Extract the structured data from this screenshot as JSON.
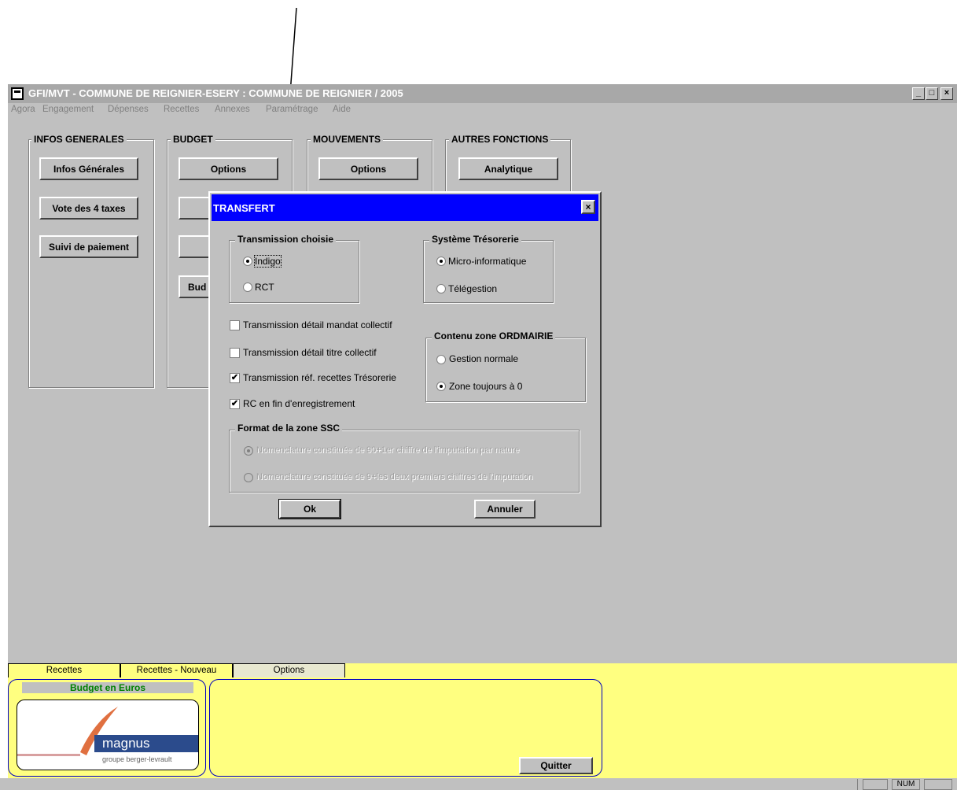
{
  "window": {
    "title": "GFI/MVT - COMMUNE DE REIGNIER-ESERY : COMMUNE DE REIGNIER / 2005",
    "controls": {
      "minimize": "_",
      "maximize": "□",
      "close": "×"
    }
  },
  "menu": [
    "Agora",
    "Engagement",
    "Dépenses",
    "Recettes",
    "Annexes",
    "Paramétrage",
    "Aide"
  ],
  "groups": {
    "infos": {
      "title": "INFOS GENERALES",
      "buttons": [
        "Infos Générales",
        "Vote des 4 taxes",
        "Suivi de paiement"
      ]
    },
    "budget": {
      "title": "BUDGET",
      "buttons": [
        "Options",
        "Bud"
      ]
    },
    "mouvements": {
      "title": "MOUVEMENTS",
      "buttons": [
        "Options"
      ]
    },
    "autres": {
      "title": "AUTRES FONCTIONS",
      "buttons": [
        "Analytique"
      ]
    }
  },
  "dialog": {
    "title": "TRANSFERT",
    "close": "×",
    "transmission": {
      "title": "Transmission choisie",
      "options": [
        "Indigo",
        "RCT"
      ],
      "selected": "Indigo"
    },
    "tresorerie": {
      "title": "Système Trésorerie",
      "options": [
        "Micro-informatique",
        "Télégestion"
      ],
      "selected": "Micro-informatique"
    },
    "ordmairie": {
      "title": "Contenu zone ORDMAIRIE",
      "options": [
        "Gestion normale",
        "Zone toujours à 0"
      ],
      "selected": "Zone toujours à 0"
    },
    "checkboxes": [
      {
        "label": "Transmission détail mandat collectif",
        "checked": false
      },
      {
        "label": "Transmission détail titre collectif",
        "checked": false
      },
      {
        "label": "Transmission réf. recettes Trésorerie",
        "checked": true
      },
      {
        "label": "RC en fin d'enregistrement",
        "checked": true
      }
    ],
    "ssc": {
      "title": "Format de la zone SSC",
      "options": [
        "Nomenclature constituée de 90+1er chiffre de l'imputation par nature",
        "Nomenclature constituée de 9+les deux premiers chiffres de l'imputation"
      ],
      "selected": 0
    },
    "ok": "Ok",
    "cancel": "Annuler"
  },
  "tabs": [
    "Recettes",
    "Recettes - Nouveau",
    "Options"
  ],
  "budget_label": "Budget en Euros",
  "logo": {
    "name": "magnus",
    "subtitle": "groupe berger-levrault"
  },
  "quit": "Quitter",
  "status": {
    "num": "NUM"
  },
  "colors": {
    "dialog_title": "#0000ff",
    "panel_bg": "#ffff80",
    "budget_label": "#008000",
    "logo_band": "#2b4b8c"
  }
}
